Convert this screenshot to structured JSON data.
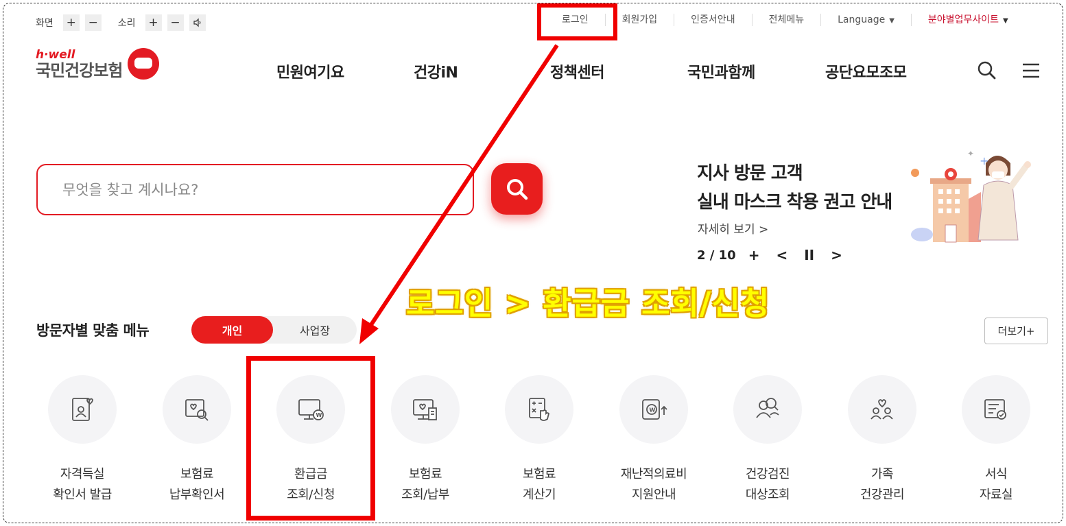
{
  "utility": {
    "screen_label": "화면",
    "sound_label": "소리",
    "plus": "+",
    "minus": "−",
    "links": [
      "로그인",
      "회원가입",
      "인증서안내",
      "전체메뉴",
      "Language",
      "분야별업무사이트"
    ]
  },
  "logo": {
    "brand": "h·well",
    "name": "국민건강보험"
  },
  "nav": [
    "민원여기요",
    "건강iN",
    "정책센터",
    "국민과함께",
    "공단요모조모"
  ],
  "search": {
    "placeholder": "무엇을 찾고 계시나요?"
  },
  "banner": {
    "line1": "지사 방문 고객",
    "line2": "실내 마스크 착용 권고 안내",
    "more": "자세히 보기 >",
    "counter": "2 / 10",
    "plus": "+",
    "prev": "<",
    "pause": "II",
    "next": ">"
  },
  "annotation": {
    "text": "로그인 > 환급금 조회/신청"
  },
  "visitor_menu": {
    "title": "방문자별 맞춤 메뉴",
    "tab_personal": "개인",
    "tab_business": "사업장",
    "more": "더보기+",
    "items": [
      {
        "line1": "자격득실",
        "line2": "확인서 발급",
        "icon": "id-card-heart-icon"
      },
      {
        "line1": "보험료",
        "line2": "납부확인서",
        "icon": "search-document-icon"
      },
      {
        "line1": "환급금",
        "line2": "조회/신청",
        "icon": "monitor-won-icon"
      },
      {
        "line1": "보험료",
        "line2": "조회/납부",
        "icon": "monitor-receipt-icon"
      },
      {
        "line1": "보험료",
        "line2": "계산기",
        "icon": "calculator-icon"
      },
      {
        "line1": "재난적의료비",
        "line2": "지원안내",
        "icon": "wallet-won-icon"
      },
      {
        "line1": "건강검진",
        "line2": "대상조회",
        "icon": "people-search-icon"
      },
      {
        "line1": "가족",
        "line2": "건강관리",
        "icon": "family-heart-icon"
      },
      {
        "line1": "서식",
        "line2": "자료실",
        "icon": "form-document-icon"
      }
    ]
  },
  "colors": {
    "accent": "#e31b23",
    "annotation": "#ff0000",
    "callout": "#ffff00"
  }
}
